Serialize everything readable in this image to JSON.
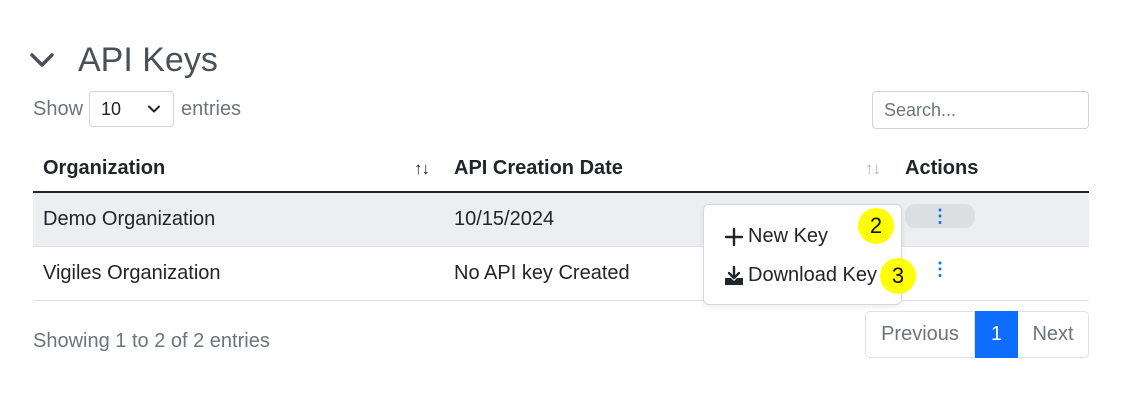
{
  "section": {
    "title": "API Keys"
  },
  "length_control": {
    "show_label": "Show",
    "selected": "10",
    "entries_label": "entries"
  },
  "search": {
    "placeholder": "Search..."
  },
  "table": {
    "headers": {
      "organization": "Organization",
      "api_creation_date": "API Creation Date",
      "actions": "Actions"
    },
    "sort_icon": "↑↓",
    "rows": [
      {
        "organization": "Demo Organization",
        "api_creation_date": "10/15/2024",
        "actions_icon": "⋮"
      },
      {
        "organization": "Vigiles Organization",
        "api_creation_date": "No API key Created",
        "actions_icon": "⋮"
      }
    ]
  },
  "dropdown": {
    "items": [
      {
        "label": "New Key",
        "icon": "plus-icon",
        "badge": "2"
      },
      {
        "label": "Download Key",
        "icon": "download-icon",
        "badge": "3"
      }
    ]
  },
  "footer": {
    "info": "Showing 1 to 2 of 2 entries"
  },
  "pagination": {
    "previous": "Previous",
    "current": "1",
    "next": "Next"
  },
  "colors": {
    "accent": "#0d6efd",
    "badge": "#ffff00",
    "striped_row": "#eceef0"
  }
}
